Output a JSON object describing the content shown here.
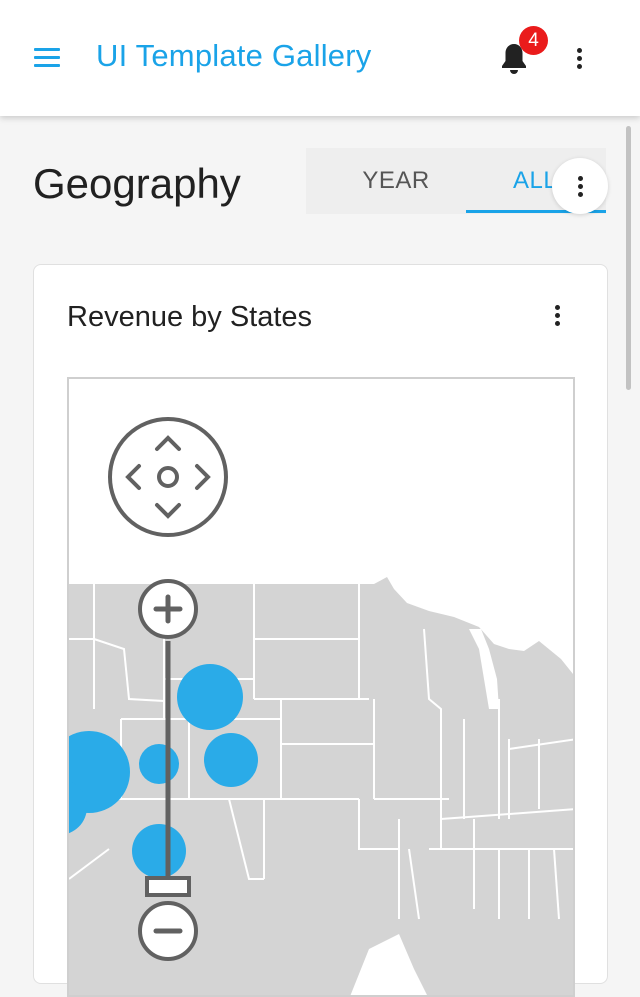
{
  "app": {
    "title": "UI Template Gallery"
  },
  "header": {
    "menu_icon": "hamburger-menu-icon",
    "notification_icon": "bell-icon",
    "notification_count": "4",
    "more_icon": "more-vert-icon"
  },
  "page": {
    "title": "Geography"
  },
  "period_tabs": [
    {
      "label": "YEAR",
      "selected": false
    },
    {
      "label": "ALL",
      "selected": true
    }
  ],
  "card": {
    "title": "Revenue by States",
    "more_icon": "more-vert-icon"
  },
  "map": {
    "controls": [
      "pan-control-icon",
      "zoom-in-icon",
      "zoom-out-icon",
      "zoom-slider"
    ],
    "zoom_level": 0.05,
    "colors": {
      "land": "#d4d4d4",
      "border": "#ffffff",
      "bubble": "#2aabe8",
      "control": "#616161",
      "accent": "#1aa3e8"
    }
  }
}
